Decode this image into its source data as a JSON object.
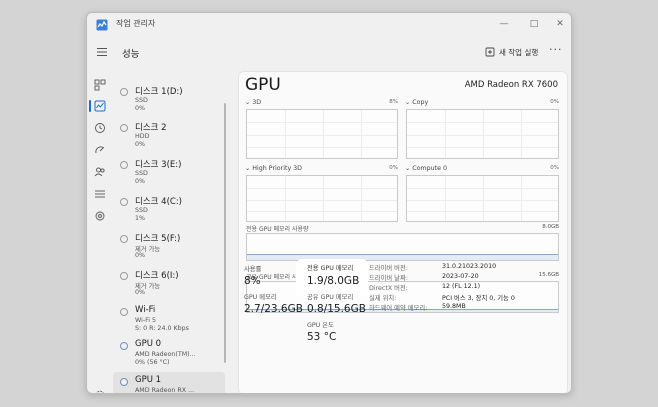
{
  "window": {
    "title": "작업 관리자",
    "page_title": "성능",
    "run_task_label": "새 작업 실행",
    "more_label": "···",
    "controls": {
      "minimize": "—",
      "maximize": "□",
      "close": "✕"
    }
  },
  "colors": {
    "accent": "#1a6fcc",
    "graph_border": "#c9c9c9",
    "selected_row": "#e2e2e2"
  },
  "nav_icons": [
    "processes-icon",
    "performance-icon",
    "app-history-icon",
    "startup-icon",
    "users-icon",
    "details-icon",
    "services-icon",
    "settings-icon"
  ],
  "devices": [
    {
      "name": "디스크 1(D:)",
      "line2": "SSD",
      "line3": "0%",
      "dot_color": "#9a9a9a",
      "selected": false
    },
    {
      "name": "디스크 2",
      "line2": "HDD",
      "line3": "0%",
      "dot_color": "#9a9a9a",
      "selected": false
    },
    {
      "name": "디스크 3(E:)",
      "line2": "SSD",
      "line3": "0%",
      "dot_color": "#9a9a9a",
      "selected": false
    },
    {
      "name": "디스크 4(C:)",
      "line2": "SSD",
      "line3": "1%",
      "dot_color": "#9a9a9a",
      "selected": false
    },
    {
      "name": "디스크 5(F:)",
      "line2": "제거 가능",
      "line3": "0%",
      "dot_color": "#9a9a9a",
      "selected": false
    },
    {
      "name": "디스크 6(I:)",
      "line2": "제거 가능",
      "line3": "0%",
      "dot_color": "#9a9a9a",
      "selected": false
    },
    {
      "name": "Wi-Fi",
      "line2": "Wi-Fi 5",
      "line3": "S: 0 R: 24.0 Kbps",
      "dot_color": "#9a9a9a",
      "selected": false
    },
    {
      "name": "GPU 0",
      "line2": "AMD Radeon(TM)...",
      "line3": "0% (56 °C)",
      "dot_color": "#6f8fb8",
      "selected": false
    },
    {
      "name": "GPU 1",
      "line2": "AMD Radeon RX ...",
      "line3": "8% (53 °C)",
      "dot_color": "#6f8fb8",
      "selected": true
    }
  ],
  "detail": {
    "title": "GPU",
    "model": "AMD Radeon RX 7600",
    "engines": [
      {
        "label": "3D",
        "percent": "8%"
      },
      {
        "label": "Copy",
        "percent": "0%"
      },
      {
        "label": "High Priority 3D",
        "percent": "0%"
      },
      {
        "label": "Compute 0",
        "percent": "0%"
      }
    ],
    "dedicated_graph": {
      "label": "전용 GPU 메모리 사용량",
      "max": "8.0GB"
    },
    "shared_graph": {
      "label": "공유 GPU 메모리 사용량",
      "max": "15.6GB"
    },
    "stats": {
      "utilization_label": "사용률",
      "utilization_value": "8%",
      "dedicated_label": "전용 GPU 메모리",
      "dedicated_value": "1.9/8.0GB",
      "gpu_mem_label": "GPU 메모리",
      "gpu_mem_value": "2.7/23.6GB",
      "shared_label": "공유 GPU 메모리",
      "shared_value": "0.8/15.6GB",
      "temp_label": "GPU 온도",
      "temp_value": "53 °C"
    },
    "info": [
      {
        "key": "드라이버 버전:",
        "value": "31.0.21023.2010"
      },
      {
        "key": "드라이버 날짜:",
        "value": "2023-07-20"
      },
      {
        "key": "DirectX 버전:",
        "value": "12 (FL 12.1)"
      },
      {
        "key": "실제 위치:",
        "value": "PCI 버스 3, 장치 0, 기능 0"
      },
      {
        "key": "하드웨어 예약 메모리:",
        "value": "59.8MB"
      }
    ]
  }
}
